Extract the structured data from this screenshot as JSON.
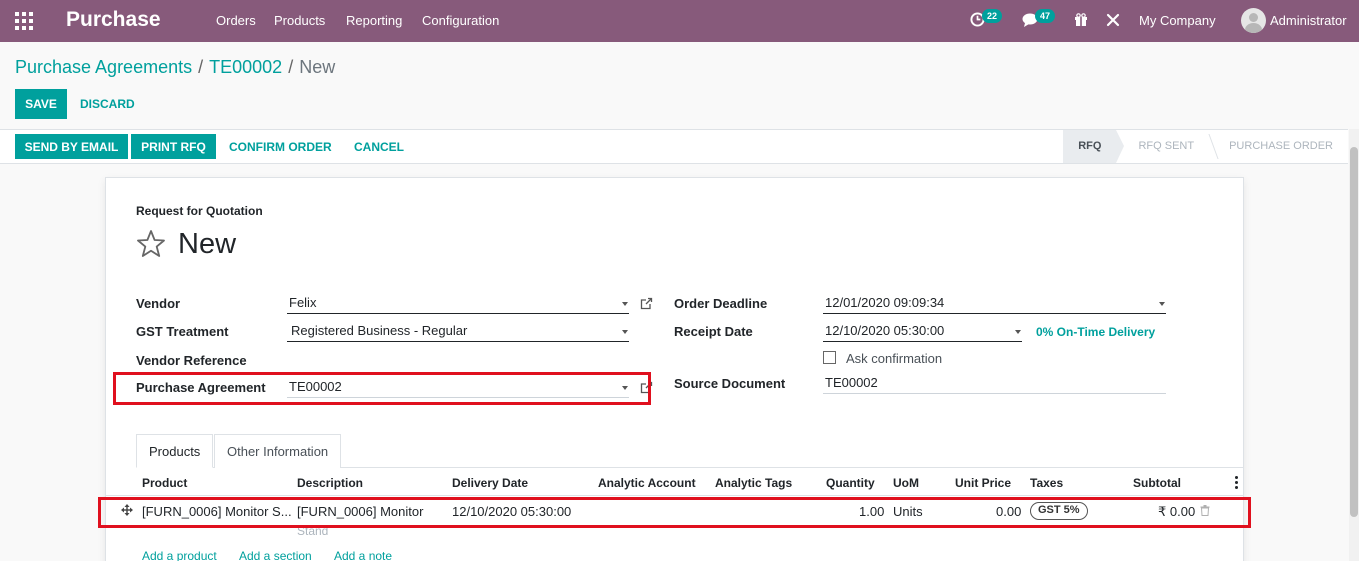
{
  "navbar": {
    "brand": "Purchase",
    "menu": [
      "Orders",
      "Products",
      "Reporting",
      "Configuration"
    ],
    "activity_count": "22",
    "message_count": "47",
    "company": "My Company",
    "user": "Administrator"
  },
  "breadcrumb": {
    "root": "Purchase Agreements",
    "parent": "TE00002",
    "current": "New"
  },
  "buttons": {
    "save": "Save",
    "discard": "Discard",
    "send_email": "Send by Email",
    "print_rfq": "Print RFQ",
    "confirm_order": "Confirm Order",
    "cancel": "Cancel"
  },
  "statusbar": [
    "RFQ",
    "RFQ Sent",
    "Purchase Order"
  ],
  "form": {
    "doc_type": "Request for Quotation",
    "name": "New",
    "left": {
      "vendor_label": "Vendor",
      "vendor": "Felix",
      "gst_label": "GST Treatment",
      "gst": "Registered Business - Regular",
      "vendor_ref_label": "Vendor Reference",
      "agreement_label": "Purchase Agreement",
      "agreement": "TE00002"
    },
    "right": {
      "deadline_label": "Order Deadline",
      "deadline": "12/01/2020 09:09:34",
      "receipt_label": "Receipt Date",
      "receipt": "12/10/2020 05:30:00",
      "on_time": "0% On-Time Delivery",
      "ask_confirmation": "Ask confirmation",
      "source_label": "Source Document",
      "source": "TE00002"
    }
  },
  "tabs": [
    "Products",
    "Other Information"
  ],
  "lines": {
    "headers": [
      "Product",
      "Description",
      "Delivery Date",
      "Analytic Account",
      "Analytic Tags",
      "Quantity",
      "UoM",
      "Unit Price",
      "Taxes",
      "Subtotal"
    ],
    "rows": [
      {
        "product": "[FURN_0006] Monitor S...",
        "description_1": "[FURN_0006] Monitor",
        "description_2": "Stand",
        "delivery_date": "12/10/2020 05:30:00",
        "quantity": "1.00",
        "uom": "Units",
        "unit_price": "0.00",
        "tax": "GST 5%",
        "subtotal": "₹ 0.00"
      }
    ],
    "add_product": "Add a product",
    "add_section": "Add a section",
    "add_note": "Add a note"
  },
  "colors": {
    "brand": "#875a7b",
    "primary": "#00a09d",
    "highlight": "#e0101e"
  }
}
